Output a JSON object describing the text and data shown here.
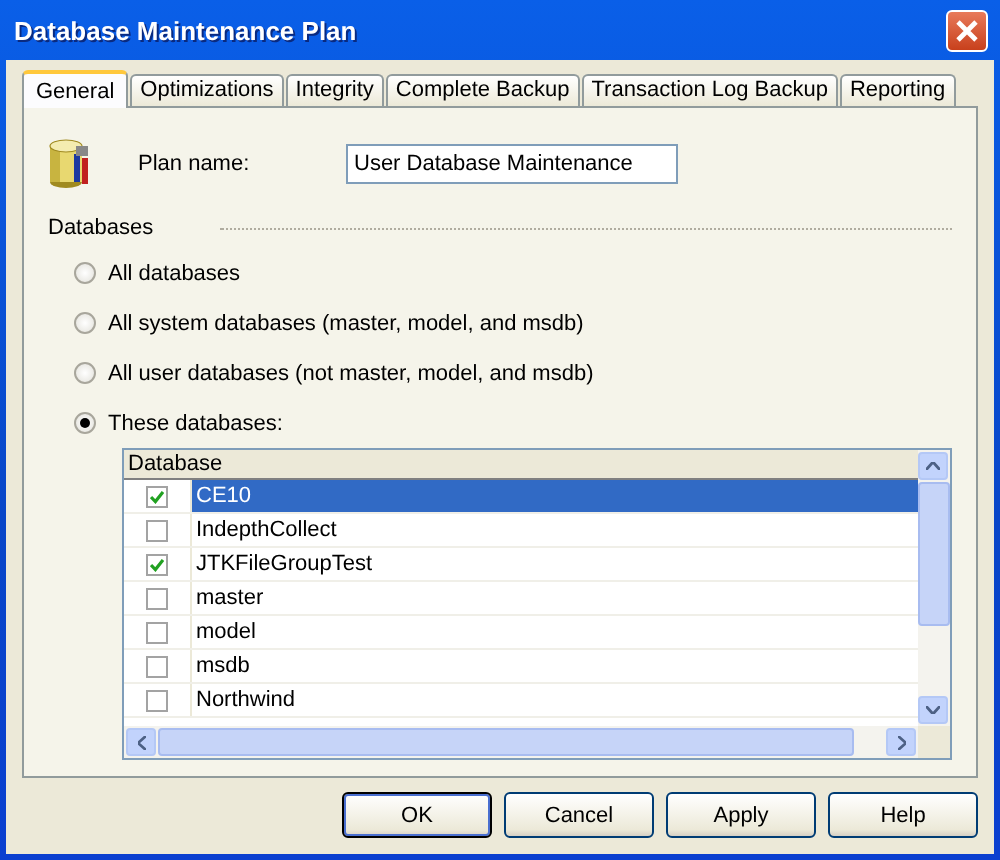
{
  "window": {
    "title": "Database Maintenance Plan"
  },
  "tabs": [
    {
      "label": "General",
      "selected": true
    },
    {
      "label": "Optimizations",
      "selected": false
    },
    {
      "label": "Integrity",
      "selected": false
    },
    {
      "label": "Complete Backup",
      "selected": false
    },
    {
      "label": "Transaction Log Backup",
      "selected": false
    },
    {
      "label": "Reporting",
      "selected": false
    }
  ],
  "plan_name": {
    "label": "Plan name:",
    "value": "User Database Maintenance"
  },
  "databases_group": {
    "title": "Databases"
  },
  "scope_options": [
    {
      "label": "All databases",
      "selected": false
    },
    {
      "label": "All system databases (master, model, and msdb)",
      "selected": false
    },
    {
      "label": "All user databases (not master, model, and msdb)",
      "selected": false
    },
    {
      "label": "These databases:",
      "selected": true
    }
  ],
  "database_list": {
    "column": "Database",
    "rows": [
      {
        "name": "CE10",
        "checked": true,
        "selected": true
      },
      {
        "name": "IndepthCollect",
        "checked": false,
        "selected": false
      },
      {
        "name": "JTKFileGroupTest",
        "checked": true,
        "selected": false
      },
      {
        "name": "master",
        "checked": false,
        "selected": false
      },
      {
        "name": "model",
        "checked": false,
        "selected": false
      },
      {
        "name": "msdb",
        "checked": false,
        "selected": false
      },
      {
        "name": "Northwind",
        "checked": false,
        "selected": false
      }
    ]
  },
  "buttons": [
    {
      "label": "OK",
      "default": true
    },
    {
      "label": "Cancel",
      "default": false
    },
    {
      "label": "Apply",
      "default": false
    },
    {
      "label": "Help",
      "default": false
    }
  ]
}
